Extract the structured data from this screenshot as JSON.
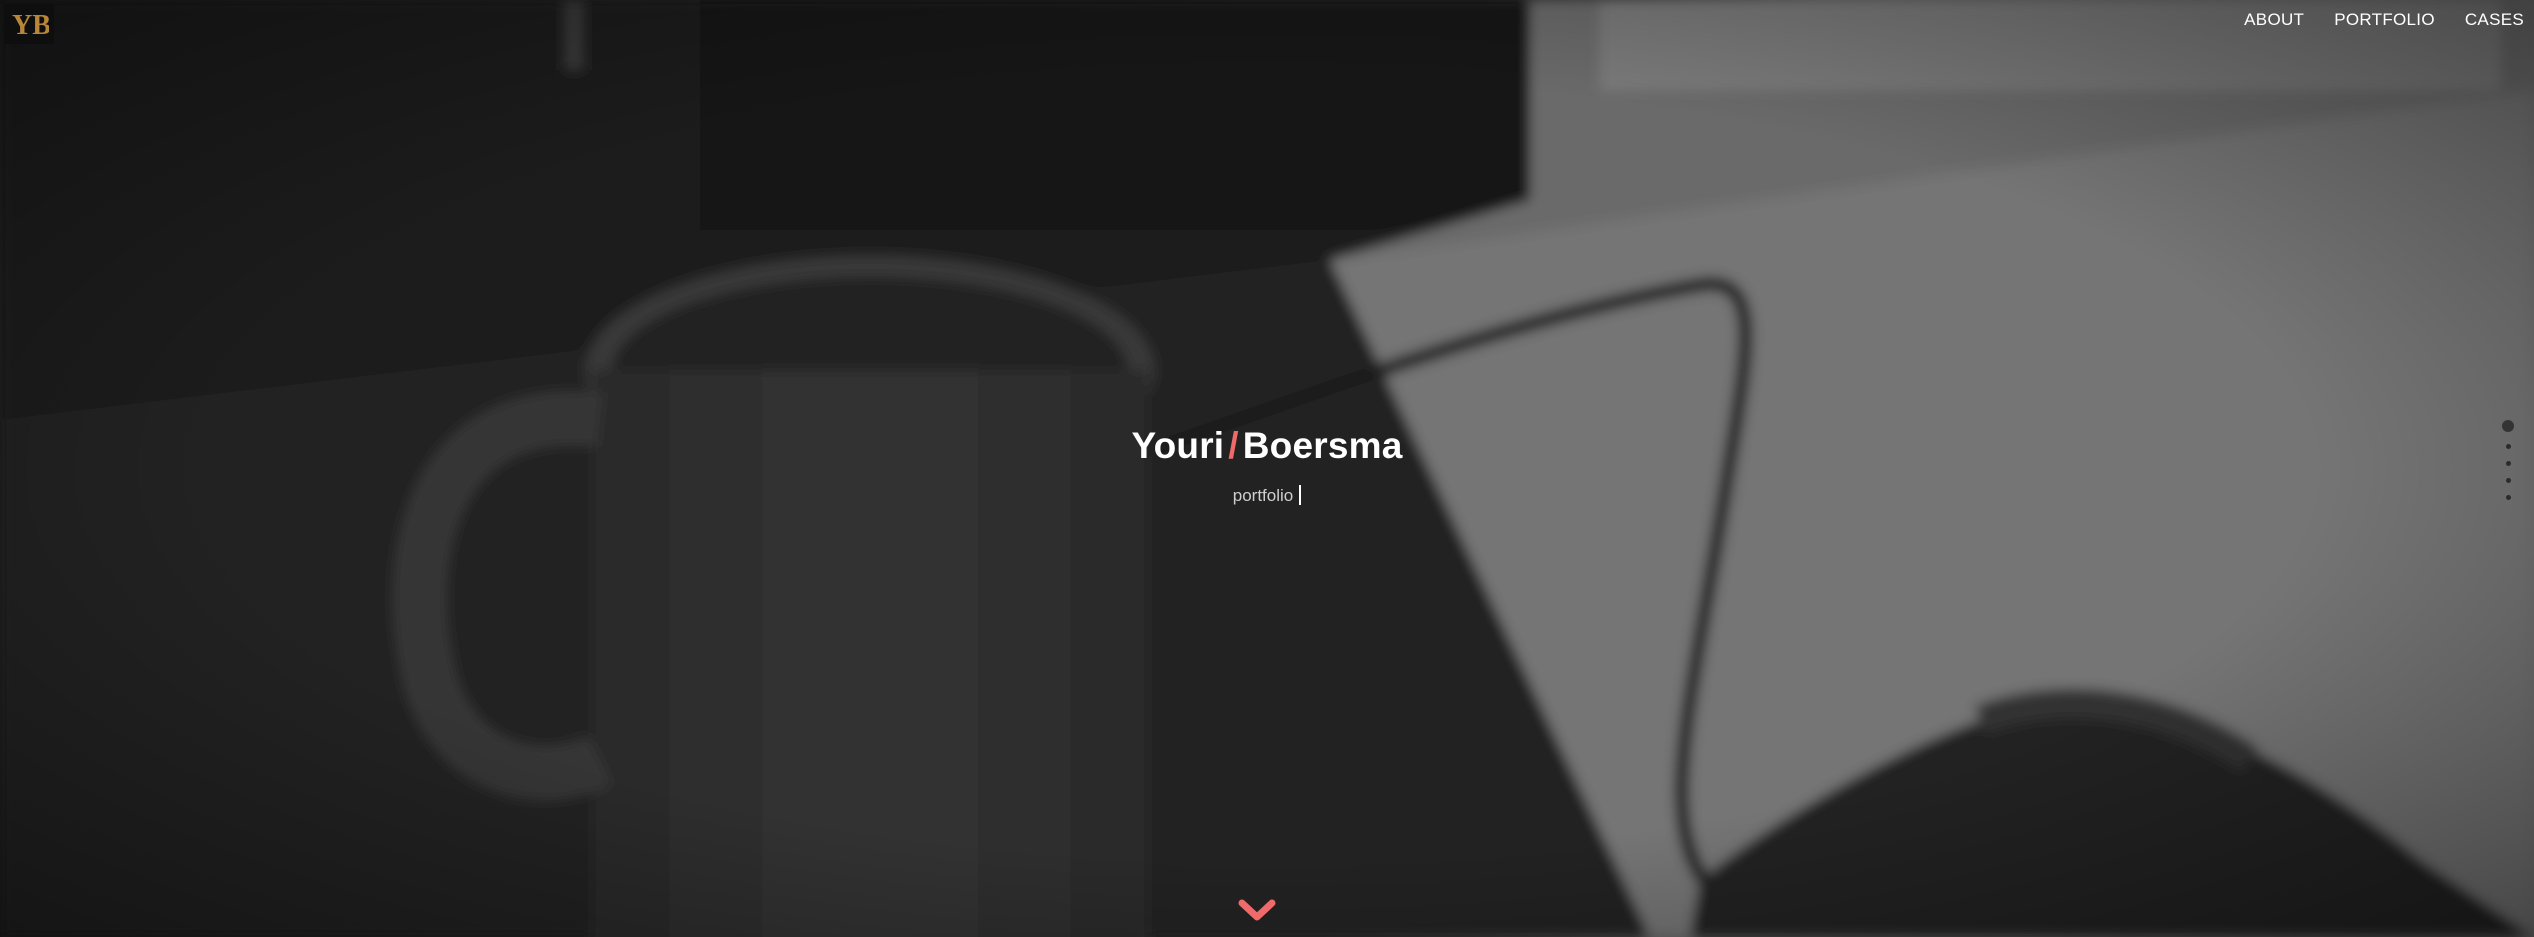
{
  "brand": {
    "logo_text": "YB",
    "accent_color": "#f06a6a",
    "logo_gold": "#b8863a"
  },
  "nav": {
    "items": [
      {
        "label": "ABOUT"
      },
      {
        "label": "PORTFOLIO"
      },
      {
        "label": "CASES"
      }
    ]
  },
  "hero": {
    "first_name": "Youri",
    "separator": "/",
    "last_name": "Boersma",
    "subtitle": "portfolio"
  },
  "section_dots": {
    "count": 5,
    "active_index": 0
  },
  "icons": {
    "scroll_down": "chevron-down-icon"
  }
}
